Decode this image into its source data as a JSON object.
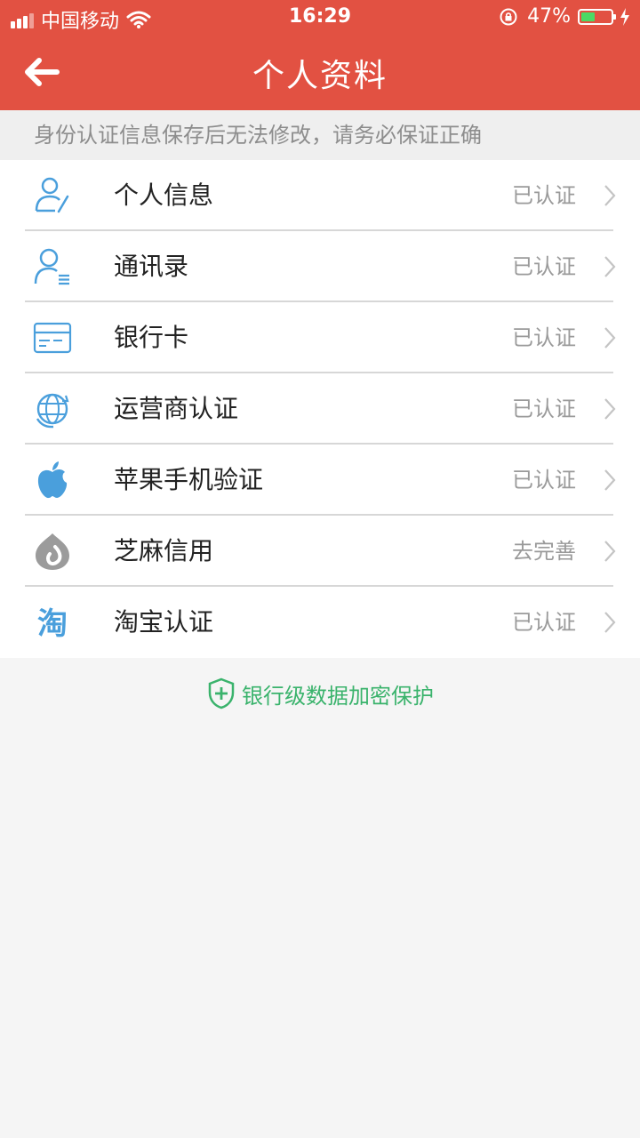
{
  "status_bar": {
    "carrier": "中国移动",
    "time": "16:29",
    "battery_text": "47%",
    "battery_level": 0.47,
    "colors": {
      "battery_fill": "#4cd964"
    }
  },
  "header": {
    "title": "个人资料",
    "back_icon": "arrow-left-icon",
    "background": "#e25142"
  },
  "notice": "身份认证信息保存后无法修改，请务必保证正确",
  "items": [
    {
      "label": "个人信息",
      "status": "已认证",
      "icon": "person-edit-icon"
    },
    {
      "label": "通讯录",
      "status": "已认证",
      "icon": "contacts-icon"
    },
    {
      "label": "银行卡",
      "status": "已认证",
      "icon": "bank-card-icon"
    },
    {
      "label": "运营商认证",
      "status": "已认证",
      "icon": "globe-refresh-icon"
    },
    {
      "label": "苹果手机验证",
      "status": "已认证",
      "icon": "apple-icon"
    },
    {
      "label": "芝麻信用",
      "status": "去完善",
      "icon": "sesame-credit-icon"
    },
    {
      "label": "淘宝认证",
      "status": "已认证",
      "icon": "taobao-icon",
      "icon_text": "淘"
    }
  ],
  "footer_note": "银行级数据加密保护",
  "colors": {
    "accent": "#e25142",
    "icon_blue": "#4a9fdc",
    "secure_green": "#3ab36c"
  }
}
